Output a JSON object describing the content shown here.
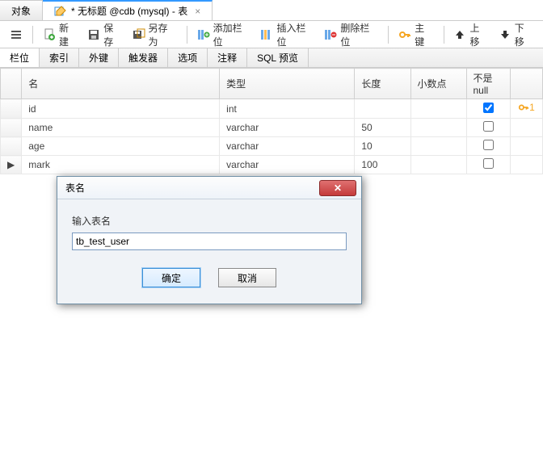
{
  "topTabs": {
    "objects": "对象",
    "editor": "* 无标题 @cdb (mysql) - 表"
  },
  "toolbar": {
    "new": "新建",
    "save": "保存",
    "saveAs": "另存为",
    "addField": "添加栏位",
    "insertField": "插入栏位",
    "deleteField": "删除栏位",
    "primaryKey": "主键",
    "moveUp": "上移",
    "moveDown": "下移"
  },
  "subTabs": [
    "栏位",
    "索引",
    "外键",
    "触发器",
    "选项",
    "注释",
    "SQL 预览"
  ],
  "columns": {
    "name": "名",
    "type": "类型",
    "length": "长度",
    "decimal": "小数点",
    "notNull": "不是 null"
  },
  "rows": [
    {
      "name": "id",
      "type": "int",
      "length": "",
      "decimal": "",
      "notNull": true,
      "pk": true,
      "pkIndex": "1",
      "marker": ""
    },
    {
      "name": "name",
      "type": "varchar",
      "length": "50",
      "decimal": "",
      "notNull": false,
      "pk": false,
      "pkIndex": "",
      "marker": ""
    },
    {
      "name": "age",
      "type": "varchar",
      "length": "10",
      "decimal": "",
      "notNull": false,
      "pk": false,
      "pkIndex": "",
      "marker": ""
    },
    {
      "name": "mark",
      "type": "varchar",
      "length": "100",
      "decimal": "",
      "notNull": false,
      "pk": false,
      "pkIndex": "",
      "marker": "▶"
    }
  ],
  "dialog": {
    "title": "表名",
    "label": "输入表名",
    "value": "tb_test_user",
    "ok": "确定",
    "cancel": "取消"
  }
}
